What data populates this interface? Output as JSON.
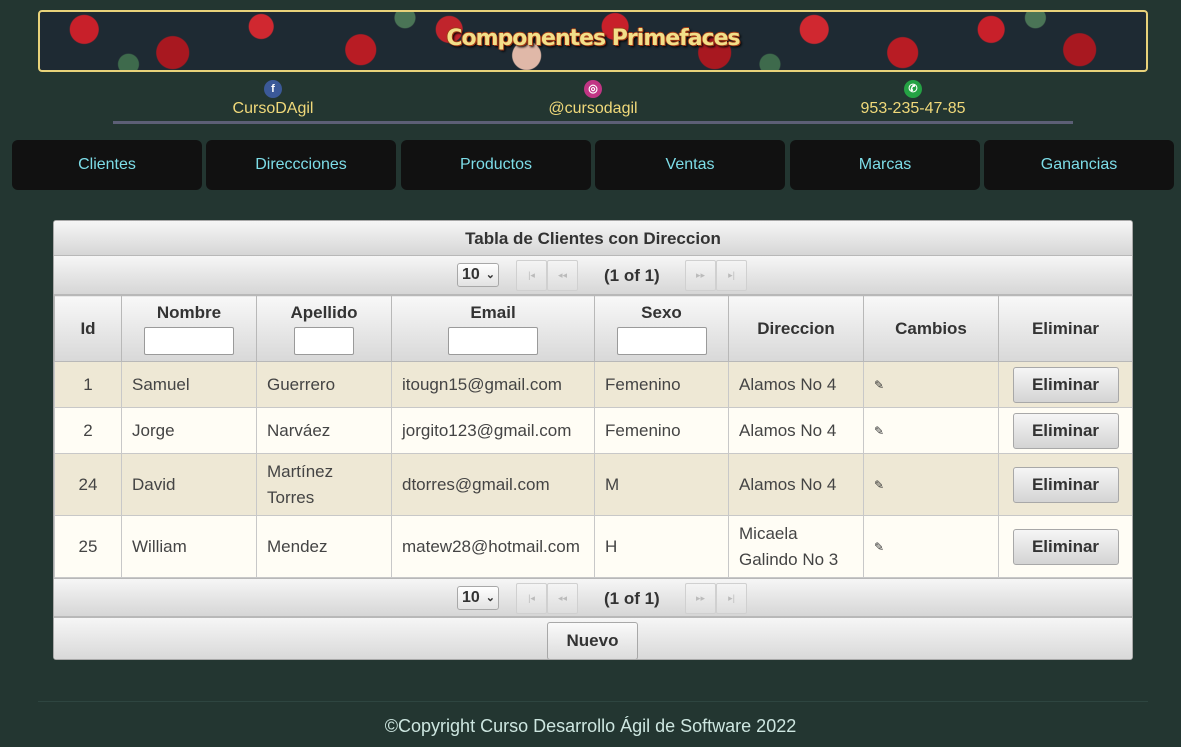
{
  "header": {
    "title": "Componentes Primefaces"
  },
  "social": [
    {
      "icon": "facebook-icon",
      "glyph": "f",
      "color": "#3b5998",
      "label": "CursoDAgil"
    },
    {
      "icon": "instagram-icon",
      "glyph": "◎",
      "color": "#c13584",
      "label": "@cursodagil"
    },
    {
      "icon": "whatsapp-icon",
      "glyph": "✆",
      "color": "#25a244",
      "label": "953-235-47-85"
    }
  ],
  "nav": [
    "Clientes",
    "Direccciones",
    "Productos",
    "Ventas",
    "Marcas",
    "Ganancias"
  ],
  "table": {
    "caption": "Tabla de Clientes con Direccion",
    "rows_per_page": "10",
    "page_info": "(1 of 1)",
    "columns": {
      "id": "Id",
      "nombre": "Nombre",
      "apellido": "Apellido",
      "email": "Email",
      "sexo": "Sexo",
      "direccion": "Direccion",
      "cambios": "Cambios",
      "eliminar": "Eliminar"
    },
    "rows": [
      {
        "id": "1",
        "nombre": "Samuel",
        "apellido": "Guerrero",
        "email": "itougn15@gmail.com",
        "sexo": "Femenino",
        "direccion": "Alamos No 4",
        "action": "Eliminar"
      },
      {
        "id": "2",
        "nombre": "Jorge",
        "apellido": "Narváez",
        "email": "jorgito123@gmail.com",
        "sexo": "Femenino",
        "direccion": "Alamos No 4",
        "action": "Eliminar"
      },
      {
        "id": "24",
        "nombre": "David",
        "apellido": "Martínez Torres",
        "email": "dtorres@gmail.com",
        "sexo": "M",
        "direccion": "Alamos No 4",
        "action": "Eliminar"
      },
      {
        "id": "25",
        "nombre": "William",
        "apellido": "Mendez",
        "email": "matew28@hotmail.com",
        "sexo": "H",
        "direccion": "Micaela Galindo No 3",
        "action": "Eliminar"
      }
    ],
    "new_button": "Nuevo"
  },
  "footer": {
    "copyright": "©Copyright Curso Desarrollo Ágil de Software 2022"
  }
}
